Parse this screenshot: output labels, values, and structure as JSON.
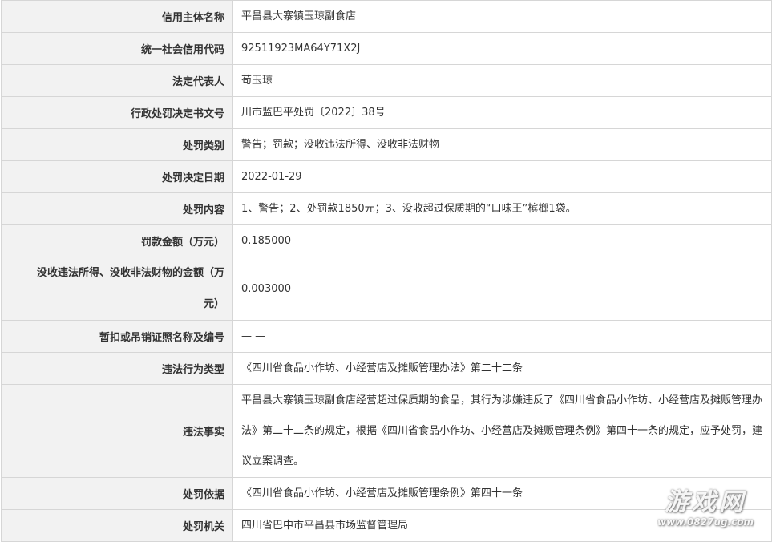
{
  "rows": [
    {
      "label": "信用主体名称",
      "value": "平昌县大寨镇玉琼副食店"
    },
    {
      "label": "统一社会信用代码",
      "value": "92511923MA64Y71X2J"
    },
    {
      "label": "法定代表人",
      "value": "苟玉琼"
    },
    {
      "label": "行政处罚决定书文号",
      "value": "川市监巴平处罚〔2022〕38号"
    },
    {
      "label": "处罚类别",
      "value": "警告；罚款；没收违法所得、没收非法财物"
    },
    {
      "label": "处罚决定日期",
      "value": "2022-01-29"
    },
    {
      "label": "处罚内容",
      "value": "1、警告；2、处罚款1850元；3、没收超过保质期的“口味王”槟榔1袋。"
    },
    {
      "label": "罚款金额（万元）",
      "value": "0.185000"
    },
    {
      "label_line1": "没收违法所得、没收非法财物的金额（万",
      "label_line2": "元）",
      "value": "0.003000"
    },
    {
      "label": "暂扣或吊销证照名称及编号",
      "value": "— —"
    },
    {
      "label": "违法行为类型",
      "value": "《四川省食品小作坊、小经营店及摊贩管理办法》第二十二条"
    },
    {
      "label": "违法事实",
      "value": "平昌县大寨镇玉琼副食店经营超过保质期的食品，其行为涉嫌违反了《四川省食品小作坊、小经营店及摊贩管理办法》第二十二条的规定，根据《四川省食品小作坊、小经营店及摊贩管理条例》第四十一条的规定，应予处罚，建议立案调查。"
    },
    {
      "label": "处罚依据",
      "value": "《四川省食品小作坊、小经营店及摊贩管理条例》第四十一条"
    },
    {
      "label": "处罚机关",
      "value": "四川省巴中市平昌县市场监督管理局"
    }
  ],
  "watermark": {
    "title": "游戏网",
    "url": "www.0827ug.com"
  }
}
